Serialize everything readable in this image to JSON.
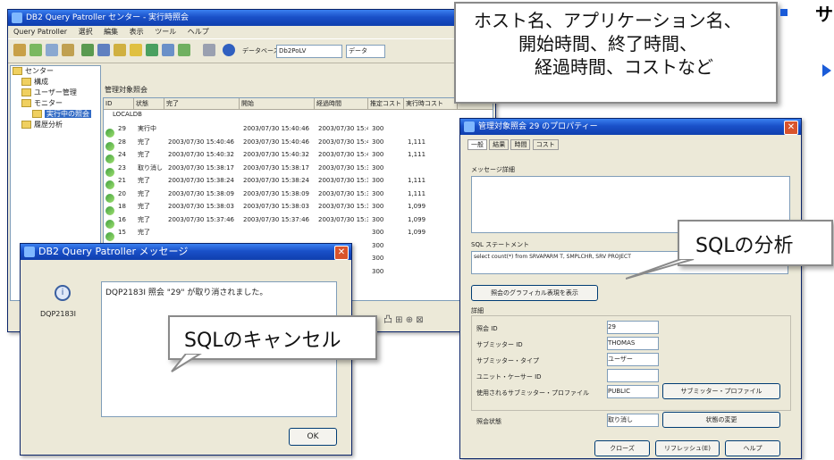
{
  "main_window": {
    "title": "DB2 Query Patroller センター - 実行時照会",
    "menu": [
      "Query Patroller",
      "選択",
      "編集",
      "表示",
      "ツール",
      "ヘルプ"
    ],
    "toolbar_label": "データベース",
    "toolbar_combo": "Db2PoLV",
    "toolbar_combo2": "データ",
    "tree": [
      {
        "label": "センター",
        "level": 0
      },
      {
        "label": "構成",
        "level": 1
      },
      {
        "label": "ユーザー管理",
        "level": 1
      },
      {
        "label": "モニター",
        "level": 1
      },
      {
        "label": "実行中の照会",
        "level": 2,
        "selected": true
      },
      {
        "label": "履歴分析",
        "level": 1
      }
    ],
    "panel_title": "管理対象照会",
    "columns": [
      "ID",
      "状態",
      "完了",
      "開始",
      "経過時間",
      "推定コスト",
      "実行時コスト"
    ],
    "group_label": "LOCALDB",
    "rows": [
      {
        "id": "29",
        "status": "実行中",
        "completed": "",
        "started": "2003/07/30 15:40:46",
        "cost": "300",
        "extra": ""
      },
      {
        "id": "28",
        "status": "完了",
        "completed": "2003/07/30 15:40:46",
        "started": "2003/07/30 15:40:46",
        "cost": "300",
        "extra": "1,111"
      },
      {
        "id": "24",
        "status": "完了",
        "completed": "2003/07/30 15:40:32",
        "started": "2003/07/30 15:40:32",
        "cost": "300",
        "extra": "1,111"
      },
      {
        "id": "23",
        "status": "取り消し",
        "completed": "2003/07/30 15:38:17",
        "started": "2003/07/30 15:38:17",
        "cost": "300",
        "extra": ""
      },
      {
        "id": "21",
        "status": "完了",
        "completed": "2003/07/30 15:38:24",
        "started": "2003/07/30 15:38:24",
        "cost": "300",
        "extra": "1,111"
      },
      {
        "id": "20",
        "status": "完了",
        "completed": "2003/07/30 15:38:09",
        "started": "2003/07/30 15:38:09",
        "cost": "300",
        "extra": "1,111"
      },
      {
        "id": "18",
        "status": "完了",
        "completed": "2003/07/30 15:38:03",
        "started": "2003/07/30 15:38:03",
        "cost": "300",
        "extra": "1,099"
      },
      {
        "id": "16",
        "status": "完了",
        "completed": "2003/07/30 15:37:46",
        "started": "2003/07/30 15:37:46",
        "cost": "300",
        "extra": "1,099"
      },
      {
        "id": "15",
        "status": "完了",
        "completed": "",
        "started": "",
        "cost": "300",
        "extra": "1,099"
      },
      {
        "id": "",
        "status": "",
        "completed": "",
        "started": "",
        "cost": "300",
        "extra": ""
      },
      {
        "id": "",
        "status": "",
        "completed": "",
        "started": "",
        "cost": "300",
        "extra": ""
      },
      {
        "id": "",
        "status": "",
        "completed": "",
        "started": "",
        "cost": "300",
        "extra": ""
      }
    ]
  },
  "message_dialog": {
    "title": "DB2 Query Patroller メッセージ",
    "code": "DQP2183I",
    "message": "DQP2183I 照会 \"29\" が取り消されました。",
    "ok_label": "OK"
  },
  "props_dialog": {
    "title": "管理対象照会 29 のプロパティー",
    "tabs": [
      "一般",
      "結果",
      "時間",
      "コスト"
    ],
    "message_label": "メッセージ詳細",
    "sql_label": "SQL ステートメント",
    "sql_text": "select count(*) from SRVAPARM T, SMPLCHR, SRV PROJECT",
    "visual_explain_button": "照会のグラフィカル表現を表示",
    "details_label": "詳細",
    "fields": [
      {
        "label": "照会 ID",
        "value": "29"
      },
      {
        "label": "サブミッター ID",
        "value": "THOMAS"
      },
      {
        "label": "サブミッター・タイプ",
        "value": "ユーザー"
      },
      {
        "label": "ユニット・ケーサー ID",
        "value": ""
      },
      {
        "label": "使用されるサブミッター・プロファイル",
        "value": "PUBLIC"
      }
    ],
    "submitter_profile_button": "サブミッター・プロファイル",
    "result_dest_label": "照会状態",
    "result_dest_value": "取り消し",
    "change_button": "状態の変更",
    "footer_buttons": [
      "クローズ",
      "リフレッシュ(E)",
      "ヘルプ"
    ]
  },
  "callouts": {
    "top": [
      "ホスト名、アプリケーション名、",
      "開始時間、終了時間、",
      "経過時間、コストなど"
    ],
    "sql_analysis": "SQLの分析",
    "sql_cancel": "SQLのキャンセル"
  },
  "slide_edge_text": "サ",
  "colors": {
    "title_blue": "#1a50c8",
    "accent": "#1a5bd8",
    "window_bg": "#ece9d8"
  }
}
